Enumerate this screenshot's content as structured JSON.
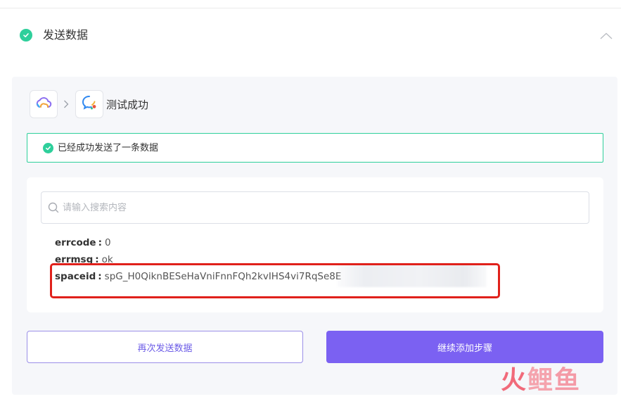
{
  "section": {
    "title": "发送数据",
    "status": "completed"
  },
  "apps": {
    "first": {
      "icon": "cloud-app-icon"
    },
    "second": {
      "icon": "chat-bubble-app-icon"
    },
    "step_label": "测试成功"
  },
  "banner": {
    "text": "已经成功发送了一条数据"
  },
  "search": {
    "placeholder": "请输入搜索内容",
    "value": ""
  },
  "result": {
    "rows": [
      {
        "key": "errcode",
        "value": "0"
      },
      {
        "key": "errmsg",
        "value": "ok"
      },
      {
        "key": "spaceid",
        "value": "spG_H0QiknBESeHaVniFnnFQh2kvIHS4vi7RqSe8E"
      }
    ]
  },
  "buttons": {
    "resend": "再次发送数据",
    "continue": "继续添加步骤"
  },
  "watermark": {
    "text": "火鲤鱼"
  },
  "colors": {
    "success": "#2ecf9b",
    "primary": "#7b61f2",
    "highlight": "#e0211b"
  }
}
